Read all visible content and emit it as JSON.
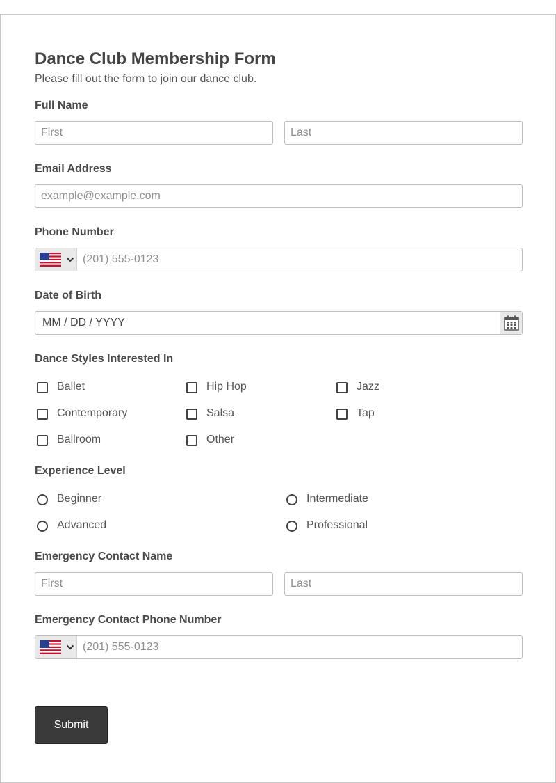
{
  "form": {
    "title": "Dance Club Membership Form",
    "subtitle": "Please fill out the form to join our dance club."
  },
  "full_name": {
    "label": "Full Name",
    "first_placeholder": "First",
    "last_placeholder": "Last"
  },
  "email": {
    "label": "Email Address",
    "placeholder": "example@example.com"
  },
  "phone": {
    "label": "Phone Number",
    "country_icon": "us-flag-icon",
    "placeholder": "(201) 555-0123"
  },
  "dob": {
    "label": "Date of Birth",
    "placeholder": "MM / DD / YYYY",
    "icon": "calendar-icon"
  },
  "dance_styles": {
    "label": "Dance Styles Interested In",
    "options": [
      "Ballet",
      "Hip Hop",
      "Jazz",
      "Contemporary",
      "Salsa",
      "Tap",
      "Ballroom",
      "Other"
    ]
  },
  "experience": {
    "label": "Experience Level",
    "options": [
      "Beginner",
      "Intermediate",
      "Advanced",
      "Professional"
    ]
  },
  "emergency_name": {
    "label": "Emergency Contact Name",
    "first_placeholder": "First",
    "last_placeholder": "Last"
  },
  "emergency_phone": {
    "label": "Emergency Contact Phone Number",
    "country_icon": "us-flag-icon",
    "placeholder": "(201) 555-0123"
  },
  "submit": {
    "label": "Submit"
  },
  "colors": {
    "button_bg": "#3a3a3a",
    "border": "#bdbdbd",
    "text": "#4a4a4a"
  }
}
